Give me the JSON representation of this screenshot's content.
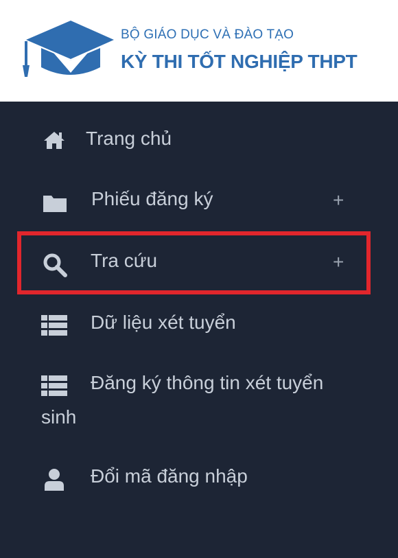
{
  "header": {
    "organization": "BỘ GIÁO DỤC VÀ ĐÀO TẠO",
    "exam_title": "KỲ THI TỐT NGHIỆP THPT",
    "brand_color": "#2f6db0"
  },
  "menu": {
    "items": [
      {
        "icon": "home-icon",
        "label": "Trang chủ",
        "expandable": false
      },
      {
        "icon": "folder-icon",
        "label": "Phiếu đăng ký",
        "expandable": true,
        "expand_symbol": "+"
      },
      {
        "icon": "search-icon",
        "label": "Tra cứu",
        "expandable": true,
        "expand_symbol": "+",
        "highlighted": true
      },
      {
        "icon": "table-icon",
        "label": "Dữ liệu xét tuyển",
        "expandable": false
      },
      {
        "icon": "table-icon",
        "label_line1": "Đăng ký thông tin xét tuyển",
        "label_line2": "sinh",
        "expandable": false
      },
      {
        "icon": "user-icon",
        "label": "Đổi mã đăng nhập",
        "expandable": false
      }
    ],
    "background_color": "#1d2535",
    "highlight_color": "#e1262c"
  }
}
